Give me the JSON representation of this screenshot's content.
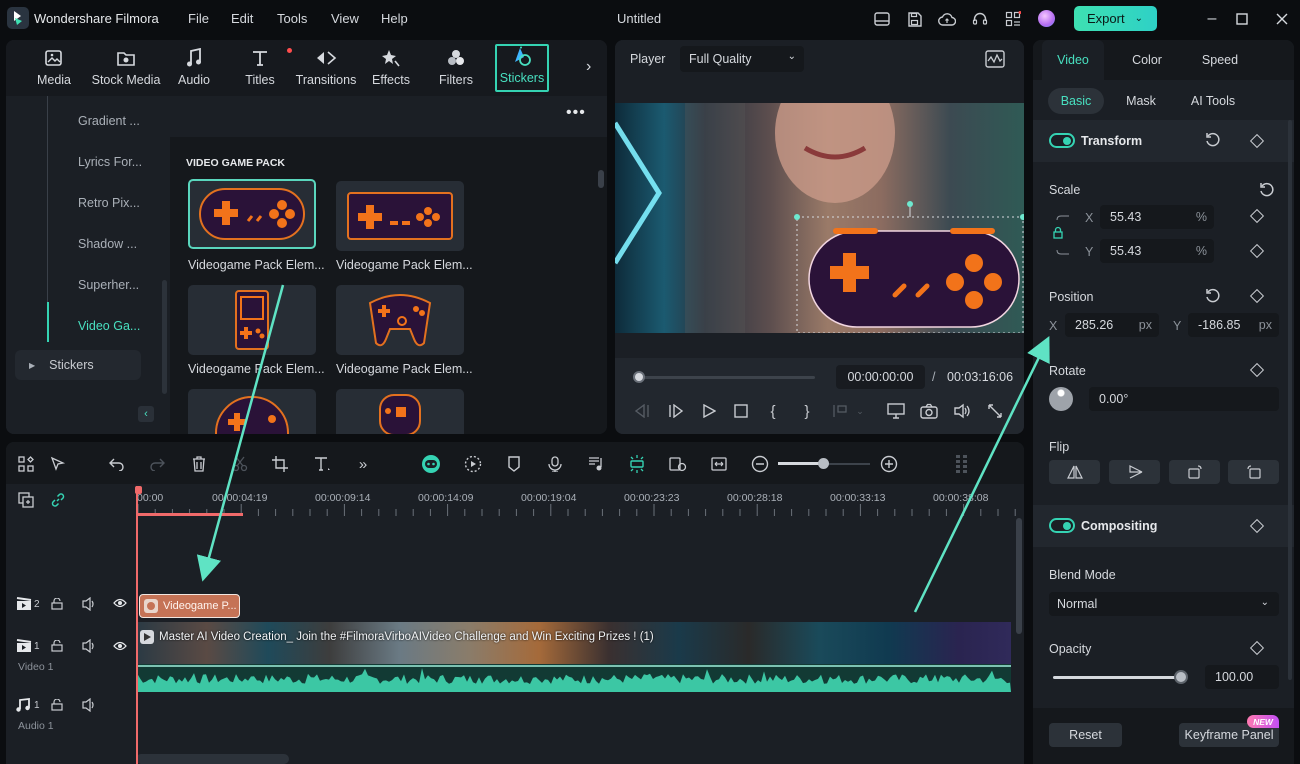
{
  "app": {
    "name": "Wondershare Filmora",
    "document_title": "Untitled",
    "menu": [
      "File",
      "Edit",
      "Tools",
      "View",
      "Help"
    ],
    "export_label": "Export",
    "accent_color": "#35d3b3"
  },
  "library": {
    "tabs": [
      {
        "label": "Media",
        "icon": "media-icon"
      },
      {
        "label": "Stock Media",
        "icon": "stock-media-icon"
      },
      {
        "label": "Audio",
        "icon": "music-note-icon"
      },
      {
        "label": "Titles",
        "icon": "titles-icon",
        "badge": true
      },
      {
        "label": "Transitions",
        "icon": "transitions-icon"
      },
      {
        "label": "Effects",
        "icon": "effects-icon"
      },
      {
        "label": "Filters",
        "icon": "filters-icon"
      },
      {
        "label": "Stickers",
        "icon": "stickers-icon",
        "active": true
      }
    ],
    "categories": [
      "Gradient ...",
      "Lyrics For...",
      "Retro Pix...",
      "Shadow ...",
      "Superher...",
      "Video Ga..."
    ],
    "active_category": "Video Ga...",
    "group_label": "Stickers",
    "section_title": "VIDEO GAME PACK",
    "items": [
      {
        "label": "Videogame Pack Elem...",
        "selected": true
      },
      {
        "label": "Videogame Pack Elem..."
      },
      {
        "label": "Videogame Pack Elem..."
      },
      {
        "label": "Videogame Pack Elem..."
      }
    ]
  },
  "player": {
    "label": "Player",
    "quality": "Full Quality",
    "current_time": "00:00:00:00",
    "separator": "/",
    "total_time": "00:03:16:06",
    "progress": 0
  },
  "properties": {
    "tabs": [
      "Video",
      "Color",
      "Speed"
    ],
    "active_tab": "Video",
    "subtabs": [
      "Basic",
      "Mask",
      "AI Tools"
    ],
    "active_subtab": "Basic",
    "transform": {
      "title": "Transform",
      "enabled": true,
      "scale_label": "Scale",
      "scale_x": "55.43",
      "scale_y": "55.43",
      "scale_unit": "%",
      "position_label": "Position",
      "pos_x": "285.26",
      "pos_y": "-186.85",
      "pos_unit": "px",
      "rotate_label": "Rotate",
      "rotate_value": "0.00°",
      "flip_label": "Flip",
      "x_axis": "X",
      "y_axis": "Y"
    },
    "compositing": {
      "title": "Compositing",
      "enabled": true,
      "blend_label": "Blend Mode",
      "blend_value": "Normal",
      "opacity_label": "Opacity",
      "opacity_value": "100.00"
    },
    "reset_label": "Reset",
    "keyframe_label": "Keyframe Panel",
    "new_badge": "NEW"
  },
  "timeline": {
    "ruler": [
      "00:00",
      "00:00:04:19",
      "00:00:09:14",
      "00:00:14:09",
      "00:00:19:04",
      "00:00:23:23",
      "00:00:28:18",
      "00:00:33:13",
      "00:00:38:08"
    ],
    "zoom_level": 0.5,
    "tracks": [
      {
        "index": "2",
        "type": "video",
        "name": ""
      },
      {
        "index": "1",
        "type": "video",
        "name": "Video 1"
      },
      {
        "index": "1",
        "type": "audio",
        "name": "Audio 1"
      }
    ],
    "sticker_clip": "Videogame P...",
    "video_clip": "Master AI Video Creation_ Join the #FilmoraVirboAIVideo Challenge and Win Exciting Prizes ! (1)"
  }
}
